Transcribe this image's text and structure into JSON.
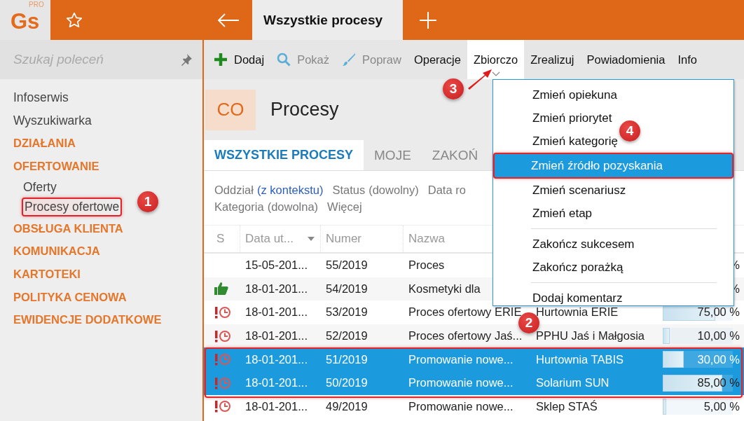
{
  "app": {
    "logo": "Gs",
    "logo_badge": "PRO"
  },
  "tabs": [
    {
      "label": "Wszystkie procesy",
      "selected": true
    }
  ],
  "search": {
    "placeholder": "Szukaj poleceń"
  },
  "sidebar": {
    "items": [
      {
        "label": "Infoserwis",
        "kind": "link",
        "selected": false
      },
      {
        "label": "Wyszukiwarka",
        "kind": "link",
        "selected": false
      },
      {
        "label": "DZIAŁANIA",
        "kind": "section",
        "selected": false
      },
      {
        "label": "OFERTOWANIE",
        "kind": "section",
        "selected": false,
        "children": [
          {
            "label": "Oferty",
            "selected": false
          },
          {
            "label": "Procesy ofertowe",
            "selected": true
          }
        ]
      },
      {
        "label": "OBSŁUGA KLIENTA",
        "kind": "section",
        "selected": false
      },
      {
        "label": "KOMUNIKACJA",
        "kind": "section",
        "selected": false
      },
      {
        "label": "KARTOTEKI",
        "kind": "section",
        "selected": false
      },
      {
        "label": "POLITYKA CENOWA",
        "kind": "section",
        "selected": false
      },
      {
        "label": "EWIDENCJE DODATKOWE",
        "kind": "section",
        "selected": false
      }
    ]
  },
  "toolbar": [
    {
      "label": "Dodaj",
      "disabled": false,
      "selected": false
    },
    {
      "label": "Pokaż",
      "disabled": true,
      "selected": false
    },
    {
      "label": "Popraw",
      "disabled": true,
      "selected": false
    },
    {
      "label": "Operacje",
      "disabled": false,
      "selected": false
    },
    {
      "label": "Zbiorczo",
      "disabled": false,
      "selected": true
    },
    {
      "label": "Zrealizuj",
      "disabled": false,
      "selected": false
    },
    {
      "label": "Powiadomienia",
      "disabled": false,
      "selected": false
    },
    {
      "label": "Info",
      "disabled": false,
      "selected": false
    }
  ],
  "header": {
    "code": "CO",
    "title": "Procesy"
  },
  "view_tabs": [
    {
      "label": "WSZYSTKIE PROCESY",
      "selected": true
    },
    {
      "label": "MOJE",
      "selected": false
    },
    {
      "label": "ZAKOŃ",
      "selected": false
    }
  ],
  "filters": [
    [
      {
        "label": "Oddział",
        "value": "(z kontekstu)",
        "linked": true
      },
      {
        "label": "Status",
        "value": "(dowolny)",
        "linked": false
      },
      {
        "label": "Data ro"
      }
    ],
    [
      {
        "label": "Kategoria",
        "value": "(dowolna)",
        "linked": false
      },
      {
        "label": "Więcej"
      }
    ]
  ],
  "table": {
    "columns": [
      "S",
      "Data ut...",
      "Numer",
      "Nazwa"
    ],
    "rows": [
      {
        "kind": "none",
        "date": "15-05-201...",
        "number": "55/2019",
        "name": "Proces",
        "progress": "%",
        "selected": false
      },
      {
        "kind": "thumb",
        "date": "18-01-201...",
        "number": "54/2019",
        "name": "Kosmetyki dla",
        "progress": "%",
        "selected": false
      },
      {
        "kind": "overdue",
        "date": "18-01-201...",
        "number": "53/2019",
        "name": "Proces ofertowy ERIE",
        "client": "Hurtownia ERIE",
        "level": 0.75,
        "progress": "75,00 %",
        "selected": false
      },
      {
        "kind": "overdue",
        "date": "18-01-201...",
        "number": "52/2019",
        "name": "Proces ofertowy Jaś...",
        "client": "PPHU Jaś i Małgosia",
        "level": 0.1,
        "progress": "10,00 %",
        "selected": false
      },
      {
        "kind": "overdue",
        "date": "18-01-201...",
        "number": "51/2019",
        "name": "Promowanie nowe...",
        "client": "Hurtownia TABIS",
        "level": 0.3,
        "progress": "30,00 %",
        "selected": true
      },
      {
        "kind": "overdue",
        "date": "18-01-201...",
        "number": "50/2019",
        "name": "Promowanie nowe...",
        "client": "Solarium SUN",
        "level": 0.85,
        "progress": "85,00 %",
        "selected": true
      },
      {
        "kind": "overdue",
        "date": "18-01-201...",
        "number": "49/2019",
        "name": "Promowanie nowe...",
        "client": "Sklep STAŚ",
        "level": 0.05,
        "progress": "5,00 %",
        "selected": false
      }
    ]
  },
  "menu": [
    {
      "kind": "item",
      "label": "Zmień opiekuna",
      "selected": false
    },
    {
      "kind": "item",
      "label": "Zmień priorytet",
      "selected": false
    },
    {
      "kind": "item",
      "label": "Zmień kategorię",
      "selected": false
    },
    {
      "kind": "item",
      "label": "Zmień źródło pozyskania",
      "selected": true
    },
    {
      "kind": "item",
      "label": "Zmień scenariusz",
      "selected": false
    },
    {
      "kind": "item",
      "label": "Zmień etap",
      "selected": false
    },
    {
      "kind": "separator"
    },
    {
      "kind": "item",
      "label": "Zakończ sukcesem",
      "selected": false
    },
    {
      "kind": "item",
      "label": "Zakończ porażką",
      "selected": false
    },
    {
      "kind": "separator"
    },
    {
      "kind": "item",
      "label": "Dodaj komentarz",
      "selected": false
    }
  ],
  "annotations": [
    "1",
    "2",
    "3",
    "4"
  ]
}
